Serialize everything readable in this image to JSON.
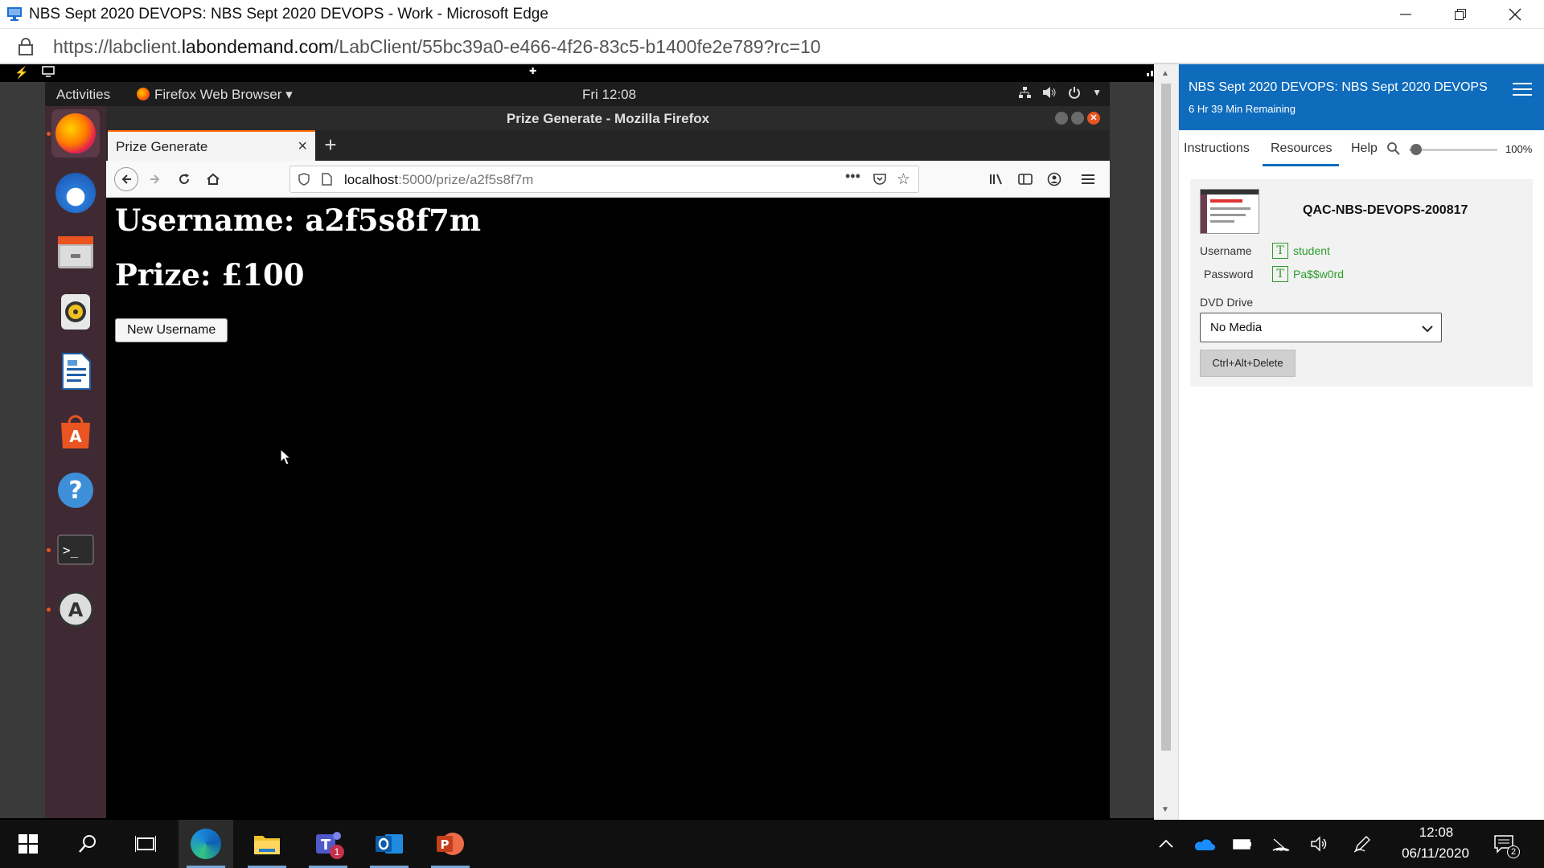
{
  "edge": {
    "window_title": "NBS Sept 2020 DEVOPS: NBS Sept 2020 DEVOPS - Work - Microsoft Edge",
    "url_base": "https://labclient.",
    "url_host": "labondemand.com",
    "url_path": "/LabClient/55bc39a0-e466-4f26-83c5-b1400fe2e789?rc=10"
  },
  "gnome": {
    "activities": "Activities",
    "app_menu": "Firefox Web Browser ▾",
    "clock": "Fri 12:08"
  },
  "firefox": {
    "window_title": "Prize Generate - Mozilla Firefox",
    "tab_title": "Prize Generate",
    "url_host": "localhost",
    "url_rest": ":5000/prize/a2f5s8f7m"
  },
  "page": {
    "username_line": "Username: a2f5s8f7m",
    "prize_line": "Prize: £100",
    "new_username_button": "New Username"
  },
  "lab_panel": {
    "title": "NBS Sept 2020 DEVOPS: NBS Sept 2020 DEVOPS",
    "remaining": "6 Hr 39 Min Remaining",
    "tabs": [
      "Instructions",
      "Resources",
      "Help"
    ],
    "active_tab": "Resources",
    "zoom": "100%",
    "zoom_level": 0.0,
    "vm_name": "QAC-NBS-DEVOPS-200817",
    "username_label": "Username",
    "username_value": "student",
    "password_label": "Password",
    "password_value": "Pa$$w0rd",
    "dvd_label": "DVD Drive",
    "dvd_value": "No Media",
    "cad_button": "Ctrl+Alt+Delete"
  },
  "taskbar": {
    "time": "12:08",
    "date": "06/11/2020",
    "teams_badge": "1",
    "notification_count": "2"
  },
  "colors": {
    "panel_accent": "#0f6cbd",
    "credential_green": "#2a9d2a",
    "firefox_tab_accent": "#ff6a00",
    "ubuntu_dock": "#3f2a33"
  }
}
